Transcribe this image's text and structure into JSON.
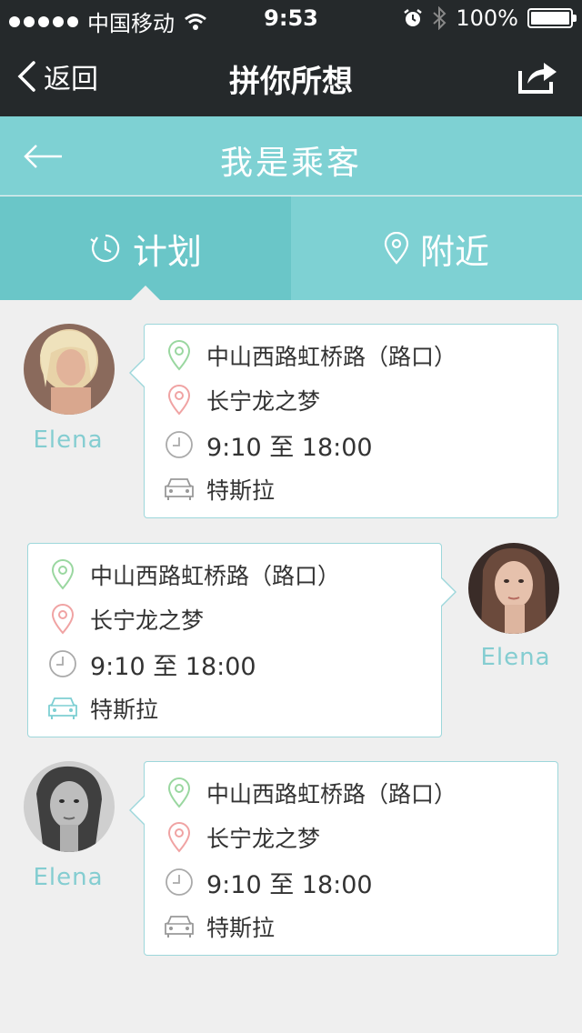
{
  "status_bar": {
    "carrier": "中国移动",
    "time": "9:53",
    "battery": "100%",
    "battery_level": 1.0
  },
  "nav": {
    "back_label": "返回",
    "title": "拼你所想"
  },
  "subheader": {
    "title": "我是乘客"
  },
  "tabs": [
    {
      "label": "计划",
      "icon": "clock-history-icon",
      "active": true
    },
    {
      "label": "附近",
      "icon": "location-pin-icon",
      "active": false
    }
  ],
  "colors": {
    "nav_bg": "#25292b",
    "teal": "#7ed1d3",
    "teal_active": "#6ac6c8",
    "start_pin": "#9ad7a0",
    "end_pin": "#f0a3a3",
    "username": "#84cdd1"
  },
  "trips": [
    {
      "user": "Elena",
      "start": "中山西路虹桥路（路口）",
      "destination": "长宁龙之梦",
      "time": "9:10 至 18:00",
      "car": "特斯拉",
      "car_icon": "car-gray-icon",
      "side": "left"
    },
    {
      "user": "Elena",
      "start": "中山西路虹桥路（路口）",
      "destination": "长宁龙之梦",
      "time": "9:10 至 18:00",
      "car": "特斯拉",
      "car_icon": "car-teal-icon",
      "side": "right"
    },
    {
      "user": "Elena",
      "start": "中山西路虹桥路（路口）",
      "destination": "长宁龙之梦",
      "time": "9:10 至 18:00",
      "car": "特斯拉",
      "car_icon": "car-gray-icon",
      "side": "left"
    }
  ]
}
